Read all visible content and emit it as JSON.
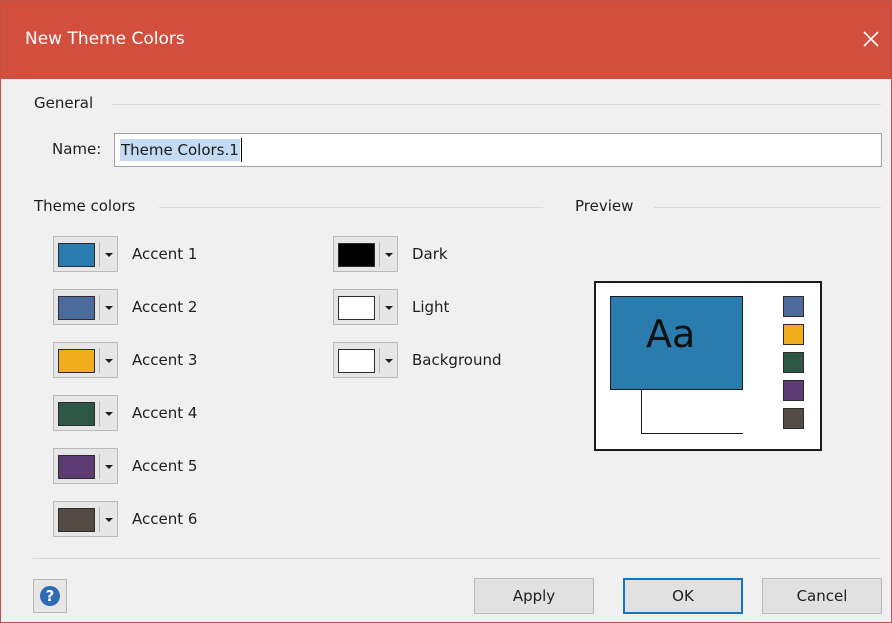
{
  "window": {
    "title": "New Theme Colors"
  },
  "general": {
    "label": "General",
    "name_label": "Name:",
    "name_value": "Theme Colors.1"
  },
  "theme_colors": {
    "label": "Theme colors",
    "accents": [
      {
        "label": "Accent 1",
        "color": "#2a7bae"
      },
      {
        "label": "Accent 2",
        "color": "#4c6a9c"
      },
      {
        "label": "Accent 3",
        "color": "#f2ad1c"
      },
      {
        "label": "Accent 4",
        "color": "#2e5647"
      },
      {
        "label": "Accent 5",
        "color": "#5c3c72"
      },
      {
        "label": "Accent 6",
        "color": "#544c44"
      }
    ],
    "base": [
      {
        "label": "Dark",
        "color": "#000000"
      },
      {
        "label": "Light",
        "color": "#ffffff"
      },
      {
        "label": "Background",
        "color": "#ffffff"
      }
    ]
  },
  "preview": {
    "label": "Preview",
    "sample_text": "Aa",
    "main_fill": "#2a7bae",
    "swatches": [
      "#4c6a9c",
      "#f2ad1c",
      "#2e5647",
      "#5c3c72",
      "#544c44"
    ]
  },
  "footer": {
    "help_icon": "question-mark-icon",
    "apply_label": "Apply",
    "ok_label": "OK",
    "cancel_label": "Cancel"
  },
  "colors": {
    "titlebar": "#d24f3d",
    "default_button_border": "#1573c8"
  }
}
